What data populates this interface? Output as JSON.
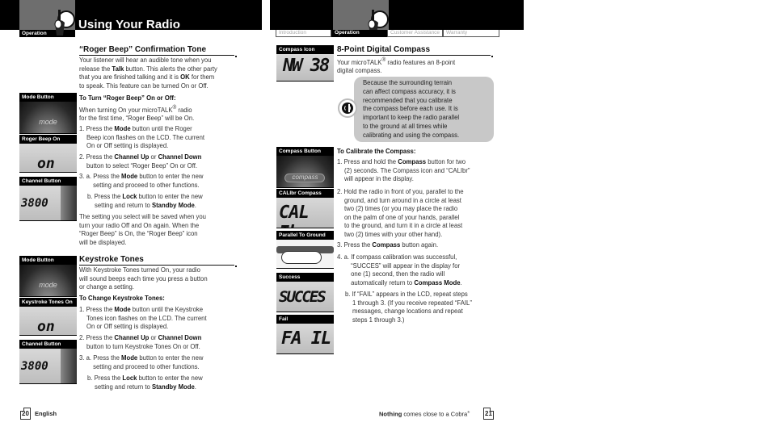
{
  "header": {
    "left_section_tab": "Operation",
    "title": "Using Your Radio",
    "right_tabs": [
      {
        "label": "Introduction",
        "active": false
      },
      {
        "label": "Operation",
        "active": true
      },
      {
        "label": "Customer Assistance",
        "active": false
      },
      {
        "label": "Warranty",
        "active": false
      }
    ]
  },
  "left_page": {
    "roger_beep": {
      "title": "“Roger Beep” Confirmation Tone",
      "intro_lines": [
        "Your listener will hear an audible tone when you",
        "release the <b>Talk</b> button. This alerts the other party",
        "that you are finished talking and it is <b>OK</b> for them",
        "to speak. This feature can be turned On or Off."
      ],
      "subheading": "To Turn “Roger Beep” On or Off:",
      "note_lines": [
        "When turning On your microTALK<sup>®</sup> radio",
        "for the first time, “Roger Beep” will be On."
      ],
      "steps": [
        [
          "1. Press the <b>Mode</b> button until the Roger",
          "Beep icon flashes on the LCD. The current",
          "On or Off setting is displayed."
        ],
        [
          "2. Press the <b>Channel Up</b> or <b>Channel Down</b>",
          "button to select “Roger Beep” On or Off."
        ],
        [
          "3. a. Press the <b>Mode</b> button to enter the new",
          "setting and proceed to other functions."
        ],
        [
          "b. Press the <b>Lock</b> button to enter the new",
          "setting and return to <b>Standby Mode</b>."
        ]
      ],
      "closing_lines": [
        "The setting you select will be saved when you",
        "turn your radio Off and On again. When the",
        "“Roger Beep” is On, the “Roger Beep” icon",
        "will be displayed."
      ]
    },
    "keystroke": {
      "title": "Keystroke Tones",
      "intro_lines": [
        "With Keystroke Tones turned On, your radio",
        "will sound beeps each time you press a button",
        "or change a setting."
      ],
      "subheading": "To Change Keystroke Tones:",
      "steps": [
        [
          "1. Press the <b>Mode</b> button until the Keystroke",
          "Tones icon flashes on the LCD. The current",
          "On or Off setting is displayed."
        ],
        [
          "2. Press the <b>Channel Up</b> or <b>Channel Down</b>",
          "button to turn Keystroke Tones On or Off."
        ],
        [
          "3. a. Press the <b>Mode</b> button to enter the new",
          "setting and proceed to other functions."
        ],
        [
          "b. Press the <b>Lock</b> button to enter the new",
          "setting and return to <b>Standby Mode</b>."
        ]
      ]
    },
    "thumbnails": [
      {
        "label": "Mode Button",
        "display": "mode"
      },
      {
        "label": "Roger Beep On",
        "display": "on"
      },
      {
        "label": "Channel Button",
        "display": "3800"
      },
      {
        "label": "Mode Button",
        "display": "mode"
      },
      {
        "label": "Keystroke Tones On",
        "display": "on"
      },
      {
        "label": "Channel Button",
        "display": "3800"
      }
    ],
    "footer": {
      "page_number": "20",
      "language": "English"
    }
  },
  "right_page": {
    "compass": {
      "title": "8-Point Digital Compass",
      "intro_lines": [
        "Your microTALK<sup>®</sup> radio features an 8-point",
        "digital compass."
      ],
      "callout_lines": [
        "Because the surrounding terrain",
        "can affect compass accuracy, it is",
        "recommended that you calibrate",
        "the compass before each use. It is",
        "important to keep the radio parallel",
        "to the ground at all times while",
        "calibrating and using the compass."
      ],
      "subheading": "To Calibrate the Compass:",
      "steps": [
        [
          "1. Press and hold the <b>Compass</b> button for two",
          "(2) seconds. The Compass icon and “CALIbr”",
          "will appear in the display."
        ],
        [
          "2. Hold the radio in front of you, parallel to the",
          "ground, and turn around in a circle at least",
          "two (2) times (or you may place the radio",
          "on the palm of one of your hands, parallel",
          "to the ground, and turn it in a circle at least",
          "two (2) times with your other hand)."
        ],
        [
          "3. Press the <b>Compass</b> button again."
        ],
        [
          "4.  a. If compass calibration was successful,",
          "“SUCCES” will appear in the display for",
          "one (1) second, then the radio will",
          "automatically return to <b>Compass Mode</b>."
        ],
        [
          "b. If “FAIL” appears in the LCD, repeat steps",
          "1 through 3. (If you receive repeated “FAIL”",
          "messages, change locations and repeat",
          "steps 1 through 3.)"
        ]
      ]
    },
    "thumbnails": [
      {
        "label": "Compass Icon",
        "display": "NW 38"
      },
      {
        "label": "Compass Button",
        "display": "compass"
      },
      {
        "label": "CALIbr Compass",
        "display": "CAL Ibr"
      },
      {
        "label": "Parallel To Ground",
        "display": ""
      },
      {
        "label": "Success",
        "display": "SUCCES"
      },
      {
        "label": "Fail",
        "display": "FA IL"
      }
    ],
    "footer": {
      "slogan_bold": "Nothing",
      "slogan_rest": " comes close to a Cobra",
      "slogan_mark": "®",
      "page_number": "21"
    }
  }
}
